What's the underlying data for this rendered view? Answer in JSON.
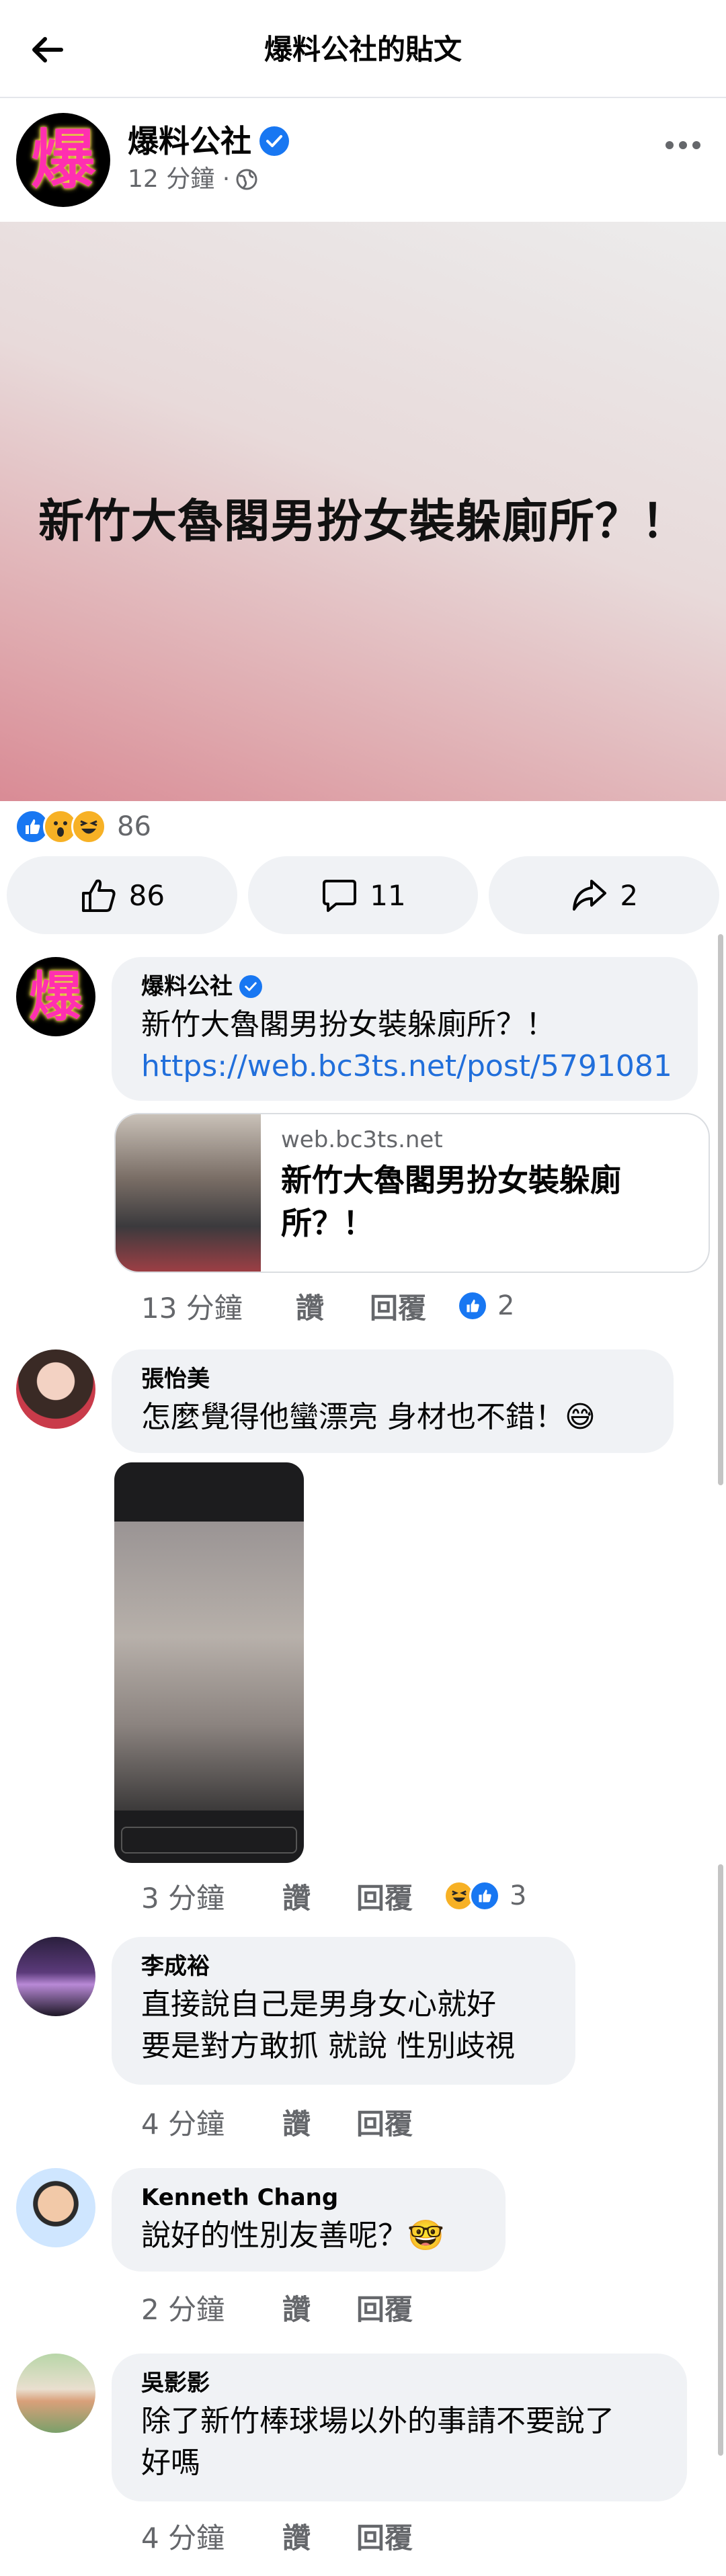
{
  "topbar": {
    "title": "爆料公社的貼文"
  },
  "post": {
    "page_name": "爆料公社",
    "avatar_glyph": "爆",
    "time": "12 分鐘 ·",
    "hero_text": "新竹大魯閣男扮女裝躲廁所？！",
    "reactions_count": "86",
    "actions": {
      "like_count": "86",
      "comment_count": "11",
      "share_count": "2"
    }
  },
  "comments": [
    {
      "name": "爆料公社",
      "text": "新竹大魯閣男扮女裝躲廁所？！",
      "link": "https://web.bc3ts.net/post/5791081",
      "link_card": {
        "domain": "web.bc3ts.net",
        "title": "新竹大魯閣男扮女裝躲廁所？！"
      },
      "time": "13 分鐘",
      "like_label": "讚",
      "reply_label": "回覆",
      "reaction_count": "2"
    },
    {
      "name": "張怡美",
      "text": "怎麼覺得他蠻漂亮 身材也不錯！😅",
      "time": "3 分鐘",
      "like_label": "讚",
      "reply_label": "回覆",
      "reaction_count": "3"
    },
    {
      "name": "李成裕",
      "text_line1": "直接說自己是男身女心就好",
      "text_line2": "要是對方敢抓 就說 性別歧視",
      "time": "4 分鐘",
      "like_label": "讚",
      "reply_label": "回覆"
    },
    {
      "name": "Kenneth Chang",
      "text": "說好的性別友善呢？🤓",
      "time": "2 分鐘",
      "like_label": "讚",
      "reply_label": "回覆"
    },
    {
      "name": "吳影影",
      "text_line1": "除了新竹棒球場以外的事請不要說了",
      "text_line2": "好嗎",
      "time": "4 分鐘",
      "like_label": "讚",
      "reply_label": "回覆"
    }
  ],
  "colors": {
    "accent": "#1877f2",
    "bubble": "#f0f2f5",
    "secondary_text": "#65676b",
    "link": "#216fdb"
  }
}
